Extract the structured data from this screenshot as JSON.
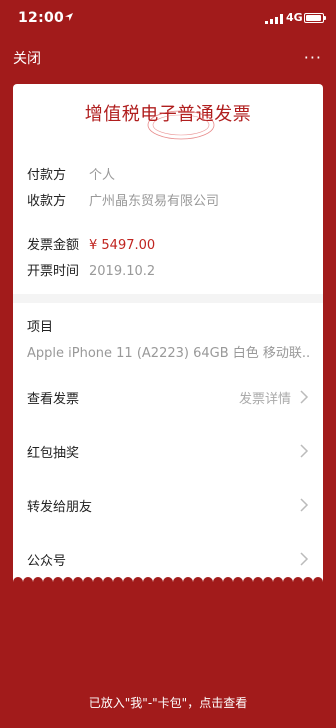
{
  "status": {
    "time": "12:00",
    "network": "4G"
  },
  "nav": {
    "close_label": "关闭",
    "more_label": "···"
  },
  "invoice": {
    "title": "增值税电子普通发票",
    "payer_label": "付款方",
    "payer_value": "个人",
    "payee_label": "收款方",
    "payee_value": "广州晶东贸易有限公司",
    "amount_label": "发票金额",
    "amount_value": "¥ 5497.00",
    "date_label": "开票时间",
    "date_value": "2019.10.2",
    "item_label": "项目",
    "item_value": "Apple iPhone 11 (A2223) 64GB 白色 移动联..."
  },
  "menu": {
    "view_invoice": "查看发票",
    "view_invoice_hint": "发票详情",
    "lottery": "红包抽奖",
    "forward": "转发给朋友",
    "official": "公众号"
  },
  "footer": {
    "text": "已放入\"我\"-\"卡包\"，点击查看"
  },
  "colors": {
    "background": "#a21b1b",
    "accent": "#c0241f"
  }
}
